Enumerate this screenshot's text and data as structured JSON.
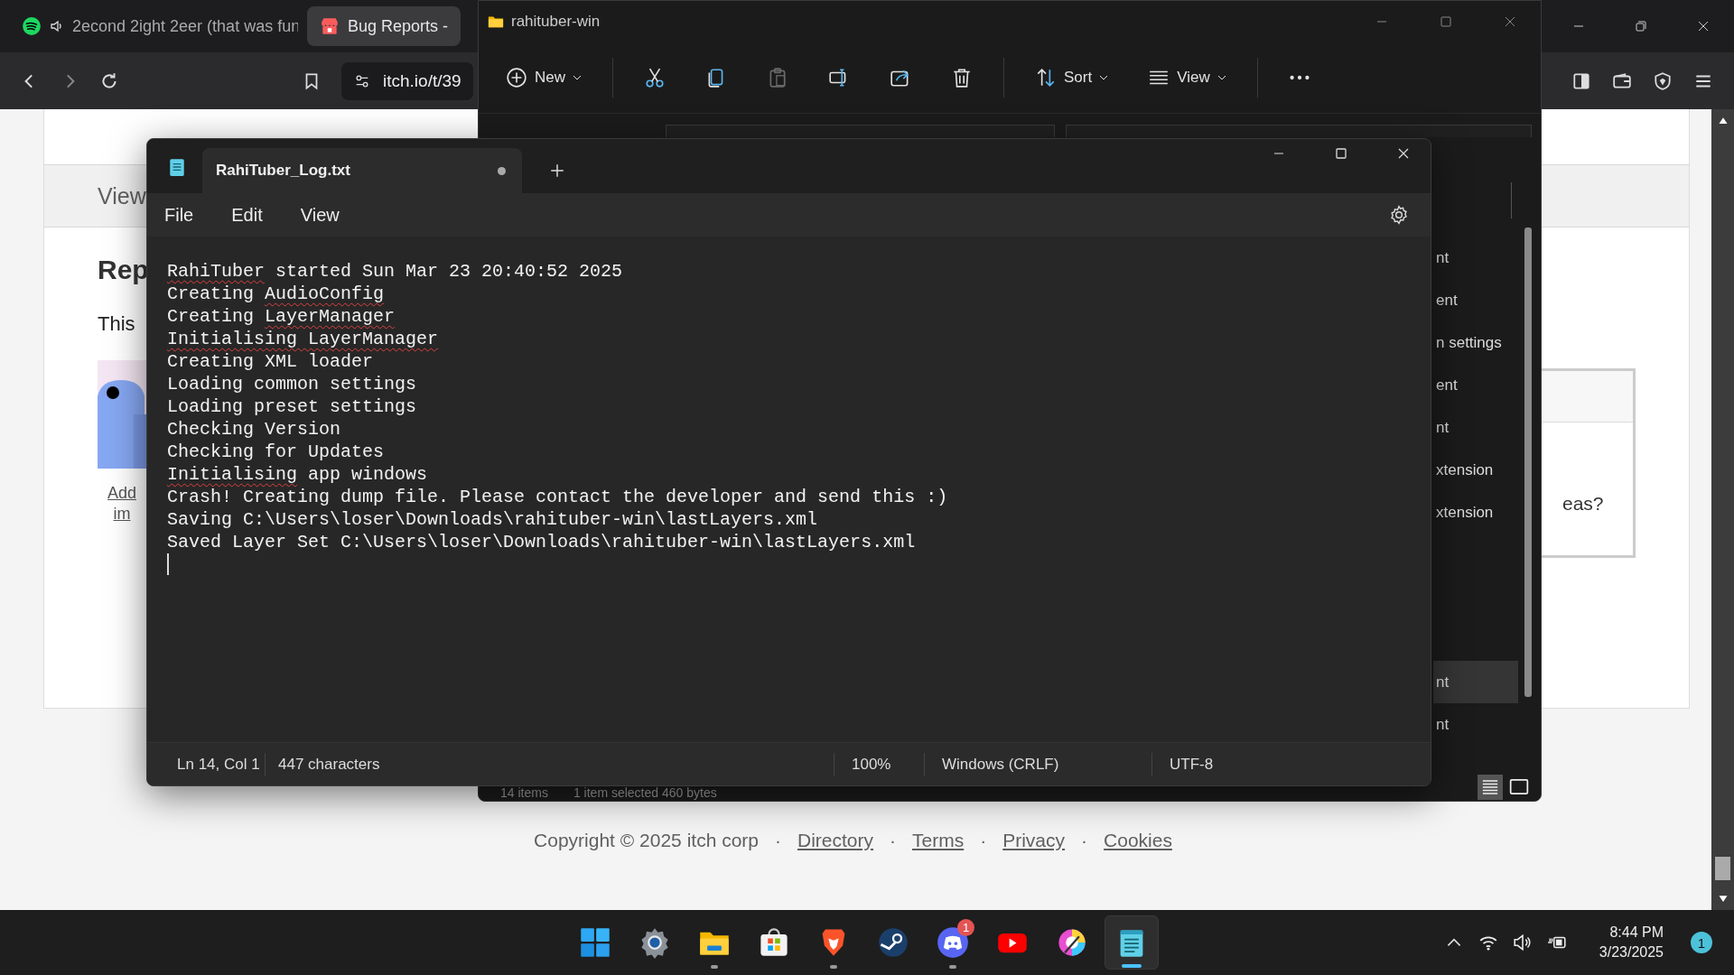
{
  "browser": {
    "tabs": [
      {
        "title": "2econd 2ight 2eer (that was fun",
        "selected": false,
        "kind": "audio"
      },
      {
        "title": "Bug Reports -",
        "selected": true,
        "kind": "site"
      }
    ],
    "address": "itch.io/t/39",
    "page": {
      "section_tab": "View",
      "heading": "Rep",
      "intro": "This",
      "image_link": "Add im",
      "side_card_text": "eas?"
    },
    "footer": {
      "copyright": "Copyright © 2025 itch corp",
      "separator": "·",
      "links": [
        "Directory",
        "Terms",
        "Privacy",
        "Cookies"
      ]
    }
  },
  "explorer": {
    "title": "rahituber-win",
    "toolbar": [
      {
        "kind": "new",
        "label": "New",
        "disabled": false
      },
      {
        "kind": "cut",
        "disabled": false
      },
      {
        "kind": "copy",
        "disabled": false
      },
      {
        "kind": "paste",
        "disabled": true
      },
      {
        "kind": "rename",
        "disabled": false
      },
      {
        "kind": "share",
        "disabled": false
      },
      {
        "kind": "delete",
        "disabled": false
      },
      {
        "kind": "sort",
        "label": "Sort",
        "disabled": false
      },
      {
        "kind": "view",
        "label": "View",
        "disabled": false
      },
      {
        "kind": "more",
        "disabled": false
      }
    ],
    "rows": [
      {
        "kind": "row",
        "text": "nt",
        "selected": false
      },
      {
        "kind": "row",
        "text": "ent",
        "selected": false
      },
      {
        "kind": "row",
        "text": "n settings",
        "selected": false
      },
      {
        "kind": "row",
        "text": "ent",
        "selected": false
      },
      {
        "kind": "row",
        "text": "nt",
        "selected": false
      },
      {
        "kind": "row",
        "text": "xtension",
        "selected": false
      },
      {
        "kind": "row",
        "text": "xtension",
        "selected": false
      },
      {
        "kind": "blank"
      },
      {
        "kind": "blank"
      },
      {
        "kind": "blank"
      },
      {
        "kind": "row",
        "text": "nt",
        "selected": true
      },
      {
        "kind": "row",
        "text": "nt",
        "selected": false
      }
    ],
    "status": {
      "count": "14 items",
      "selection": "1 item selected  460 bytes"
    },
    "views": [
      {
        "kind": "details",
        "selected": true
      },
      {
        "kind": "tiles",
        "selected": false
      }
    ]
  },
  "notepad": {
    "tab": {
      "title": "RahiTuber_Log.txt",
      "modified": true
    },
    "menu": [
      "File",
      "Edit",
      "View"
    ],
    "lines": [
      [
        {
          "text": "RahiTuber",
          "misspelled": true
        },
        {
          "text": " started Sun Mar 23 20:40:52 2025",
          "misspelled": false
        }
      ],
      [
        {
          "text": "Creating ",
          "misspelled": false
        },
        {
          "text": "AudioConfig",
          "misspelled": true
        }
      ],
      [
        {
          "text": "Creating ",
          "misspelled": false
        },
        {
          "text": "LayerManager",
          "misspelled": true
        }
      ],
      [
        {
          "text": "Initialising LayerManager",
          "misspelled": true
        }
      ],
      [
        {
          "text": "Creating XML loader",
          "misspelled": false
        }
      ],
      [
        {
          "text": "Loading common settings",
          "misspelled": false
        }
      ],
      [
        {
          "text": "Loading preset settings",
          "misspelled": false
        }
      ],
      [
        {
          "text": "Checking Version",
          "misspelled": false
        }
      ],
      [
        {
          "text": "Checking for Updates",
          "misspelled": false
        }
      ],
      [
        {
          "text": "Initialising",
          "misspelled": true
        },
        {
          "text": " app windows",
          "misspelled": false
        }
      ],
      [
        {
          "text": "Crash! Creating dump file. Please contact the developer and send this :)",
          "misspelled": false
        }
      ],
      [
        {
          "text": "Saving C:\\Users\\loser\\Downloads\\rahituber-win\\lastLayers.xml",
          "misspelled": false
        }
      ],
      [
        {
          "text": "Saved Layer Set C:\\Users\\loser\\Downloads\\rahituber-win\\lastLayers.xml",
          "misspelled": false
        }
      ]
    ],
    "status": {
      "position": "Ln 14, Col 1",
      "characters": "447 characters",
      "zoom": "100%",
      "line_endings": "Windows (CRLF)",
      "encoding": "UTF-8"
    }
  },
  "taskbar": {
    "apps": [
      {
        "kind": "start",
        "running": false,
        "selected": false
      },
      {
        "kind": "settings",
        "running": false,
        "selected": false
      },
      {
        "kind": "files",
        "running": true,
        "selected": false
      },
      {
        "kind": "store",
        "running": false,
        "selected": false
      },
      {
        "kind": "brave",
        "running": true,
        "selected": false
      },
      {
        "kind": "steam",
        "running": false,
        "selected": false
      },
      {
        "kind": "discord",
        "running": true,
        "selected": false,
        "badge": "1"
      },
      {
        "kind": "youtube",
        "running": false,
        "selected": false
      },
      {
        "kind": "paint",
        "running": false,
        "selected": false
      },
      {
        "kind": "notepad",
        "running": true,
        "selected": true
      }
    ],
    "time": "8:44 PM",
    "date": "3/23/2025",
    "notifications": "1"
  }
}
